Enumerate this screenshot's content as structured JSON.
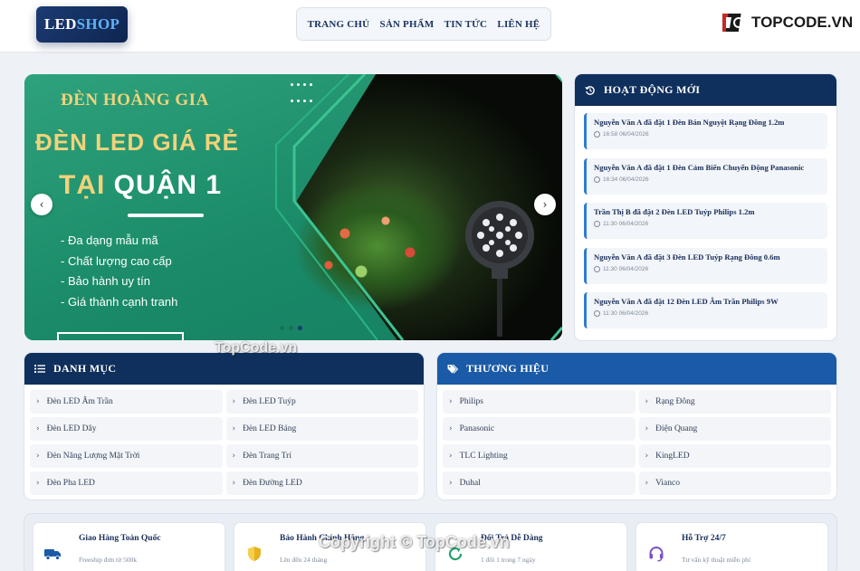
{
  "header": {
    "logo": {
      "part1": "LED",
      "part2": "SHOP"
    },
    "nav": [
      "TRANG CHỦ",
      "SẢN PHẨM",
      "TIN TỨC",
      "LIÊN HỆ"
    ],
    "brandmark": {
      "part1": "TOP",
      "part2": "CODE.VN"
    }
  },
  "slider": {
    "eyebrow": "ĐÈN HOÀNG GIA",
    "title_line1": "ĐÈN LED GIÁ RẺ",
    "title_line2_a": "TẠI ",
    "title_line2_b": "QUẬN 1",
    "bullets": [
      "- Đa dạng mẫu mã",
      "- Chất lượng cao cấp",
      "- Bảo hành uy tín",
      "- Giá thành cạnh tranh"
    ],
    "prev_icon": "chevron-left-icon",
    "next_icon": "chevron-right-icon",
    "pages": 3,
    "active_page": 3
  },
  "activity": {
    "title": "HOẠT ĐỘNG MỚI",
    "icon": "history-icon",
    "items": [
      {
        "text": "Nguyễn Văn A đã đặt 1 Đèn Bán Nguyệt Rạng Đông 1.2m",
        "time": "16:58 06/04/2026"
      },
      {
        "text": "Nguyễn Văn A đã đặt 1 Đèn Cảm Biến Chuyển Động Panasonic",
        "time": "16:34 06/04/2026"
      },
      {
        "text": "Trần Thị B đã đặt 2 Đèn LED Tuýp Philips 1.2m",
        "time": "11:30 06/04/2026"
      },
      {
        "text": "Nguyễn Văn A đã đặt 3 Đèn LED Tuýp Rạng Đông 0.6m",
        "time": "11:30 06/04/2026"
      },
      {
        "text": "Nguyễn Văn A đã đặt 12 Đèn LED Âm Trần Philips 9W",
        "time": "11:30 06/04/2026"
      }
    ]
  },
  "categories": {
    "title": "DANH MỤC",
    "icon": "list-icon",
    "items": [
      "Đèn LED Âm Trần",
      "Đèn LED Tuýp",
      "Đèn LED Dây",
      "Đèn LED Bảng",
      "Đèn Năng Lượng Mặt Trời",
      "Đèn Trang Trí",
      "Đèn Pha LED",
      "Đèn Đường LED"
    ]
  },
  "brands": {
    "title": "THƯƠNG HIỆU",
    "icon": "tags-icon",
    "items": [
      "Philips",
      "Rạng Đông",
      "Panasonic",
      "Điện Quang",
      "TLC Lighting",
      "KingLED",
      "Duhal",
      "Vianco"
    ]
  },
  "features": [
    {
      "title": "Giao Hàng Toàn Quốc",
      "sub": "Freeship đơn từ 500k",
      "icon": "truck-icon",
      "color": "#1a5aa6"
    },
    {
      "title": "Bảo Hành Chính Hãng",
      "sub": "Lên đến 24 tháng",
      "icon": "shield-icon",
      "color": "#e8b21c"
    },
    {
      "title": "Đổi Trả Dễ Dàng",
      "sub": "1 đổi 1 trong 7 ngày",
      "icon": "refresh-icon",
      "color": "#22a06b"
    },
    {
      "title": "Hỗ Trợ 24/7",
      "sub": "Tư vấn kỹ thuật miễn phí",
      "icon": "headset-icon",
      "color": "#7b4fc9"
    }
  ],
  "watermarks": [
    "TopCode.vn",
    "Copyright © TopCode.vn"
  ],
  "colors": {
    "navy": "#0f2f5c",
    "blue": "#1a5aa6",
    "accent": "#2f7bd0",
    "banner_green": "#1a8a68"
  }
}
